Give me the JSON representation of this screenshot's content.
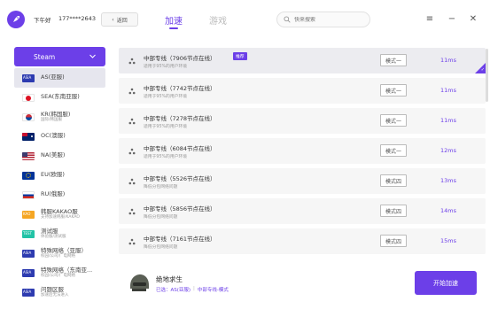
{
  "header": {
    "greeting": "下午好",
    "phone": "177****2643",
    "back_label": "返回",
    "tabs": [
      {
        "label": "加速",
        "active": true
      },
      {
        "label": "游戏",
        "active": false
      }
    ],
    "search_placeholder": "快来搜索",
    "accent_color": "#6c3fe8"
  },
  "sidebar": {
    "platform": "Steam",
    "regions": [
      {
        "label": "AS(亚服)",
        "flag": "asia",
        "selected": true
      },
      {
        "label": "SEA(东南亚服)",
        "flag": "asean"
      },
      {
        "label": "KR(韩国服)",
        "sub": "国际/韩国服",
        "flag": "korea"
      },
      {
        "label": "OC(澳服)",
        "flag": "australia"
      },
      {
        "label": "NA(美服)",
        "flag": "usa"
      },
      {
        "label": "EU(欧服)",
        "flag": "eu"
      },
      {
        "label": "RU(俄服)",
        "flag": "russia"
      },
      {
        "label": "韩服KAKAO服",
        "sub": "支持加速韩服/KAKAO",
        "flag": "kakao"
      },
      {
        "label": "测试服",
        "sub": "体验服/测试服",
        "flag": "test"
      },
      {
        "label": "特殊网络（亚服）",
        "sub": "校园/公司/广电网络",
        "flag": "asia"
      },
      {
        "label": "特殊网络（东南亚...",
        "sub": "校园/公司/广电网络",
        "flag": "asia"
      },
      {
        "label": "问题区服",
        "sub": "加速后无法进入",
        "flag": "asia"
      }
    ]
  },
  "servers": [
    {
      "name": "中部专线（7906节点在线）",
      "desc": "适用于95%的用户环境",
      "tag": "推荐",
      "mode": "模式一",
      "ping": "11ms",
      "selected": true
    },
    {
      "name": "中部专线（7742节点在线）",
      "desc": "适用于95%的用户环境",
      "mode": "模式一",
      "ping": "11ms"
    },
    {
      "name": "中部专线（7278节点在线）",
      "desc": "适用于95%的用户环境",
      "mode": "模式一",
      "ping": "11ms"
    },
    {
      "name": "中部专线（6084节点在线）",
      "desc": "适用于95%的用户环境",
      "mode": "模式一",
      "ping": "12ms"
    },
    {
      "name": "中部专线（5526节点在线）",
      "desc": "降低分包网络问题",
      "mode": "模式四",
      "ping": "13ms"
    },
    {
      "name": "中部专线（5856节点在线）",
      "desc": "降低分包网络问题",
      "mode": "模式四",
      "ping": "14ms"
    },
    {
      "name": "中部专线（7161节点在线）",
      "desc": "降低分包网络问题",
      "mode": "模式四",
      "ping": "15ms"
    }
  ],
  "footer": {
    "game_title": "绝地求生",
    "server_label": "已选：AS(亚服)",
    "line_label": "中部专线-模式",
    "start_label": "开始加速"
  }
}
